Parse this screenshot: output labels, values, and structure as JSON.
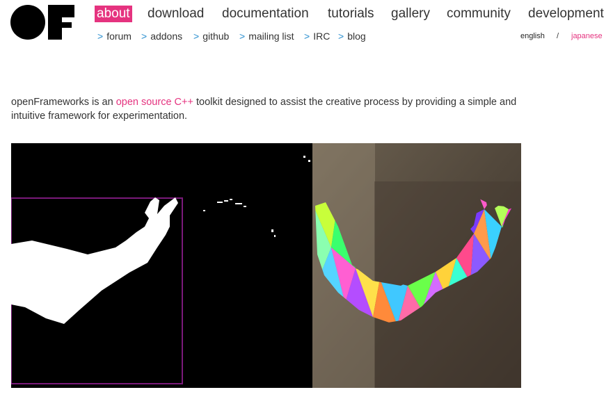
{
  "logo": {
    "alt": "OF"
  },
  "nav": {
    "main": [
      {
        "label": "about",
        "active": true
      },
      {
        "label": "download"
      },
      {
        "label": "documentation"
      },
      {
        "label": "tutorials"
      },
      {
        "label": "gallery"
      },
      {
        "label": "community"
      },
      {
        "label": "development"
      }
    ],
    "sub": [
      {
        "arrow": ">",
        "label": "forum"
      },
      {
        "arrow": ">",
        "label": "addons"
      },
      {
        "arrow": ">",
        "label": "github"
      },
      {
        "arrow": ">",
        "label": "mailing list"
      },
      {
        "arrow": ">",
        "label": "IRC"
      },
      {
        "arrow": ">",
        "label": "blog"
      }
    ]
  },
  "language": {
    "english": "english",
    "separator": "/",
    "japanese": "japanese"
  },
  "intro": {
    "before_link": "openFrameworks is an ",
    "link": "open source C++",
    "after_link": " toolkit designed to assist the creative process by providing a simple and intuitive framework for experimentation."
  },
  "colors": {
    "accent": "#e5337f",
    "sub_arrow": "#2a8fcf",
    "text": "#333333",
    "tracking_box": "#7a1a7a",
    "wall": "#4e443a"
  }
}
